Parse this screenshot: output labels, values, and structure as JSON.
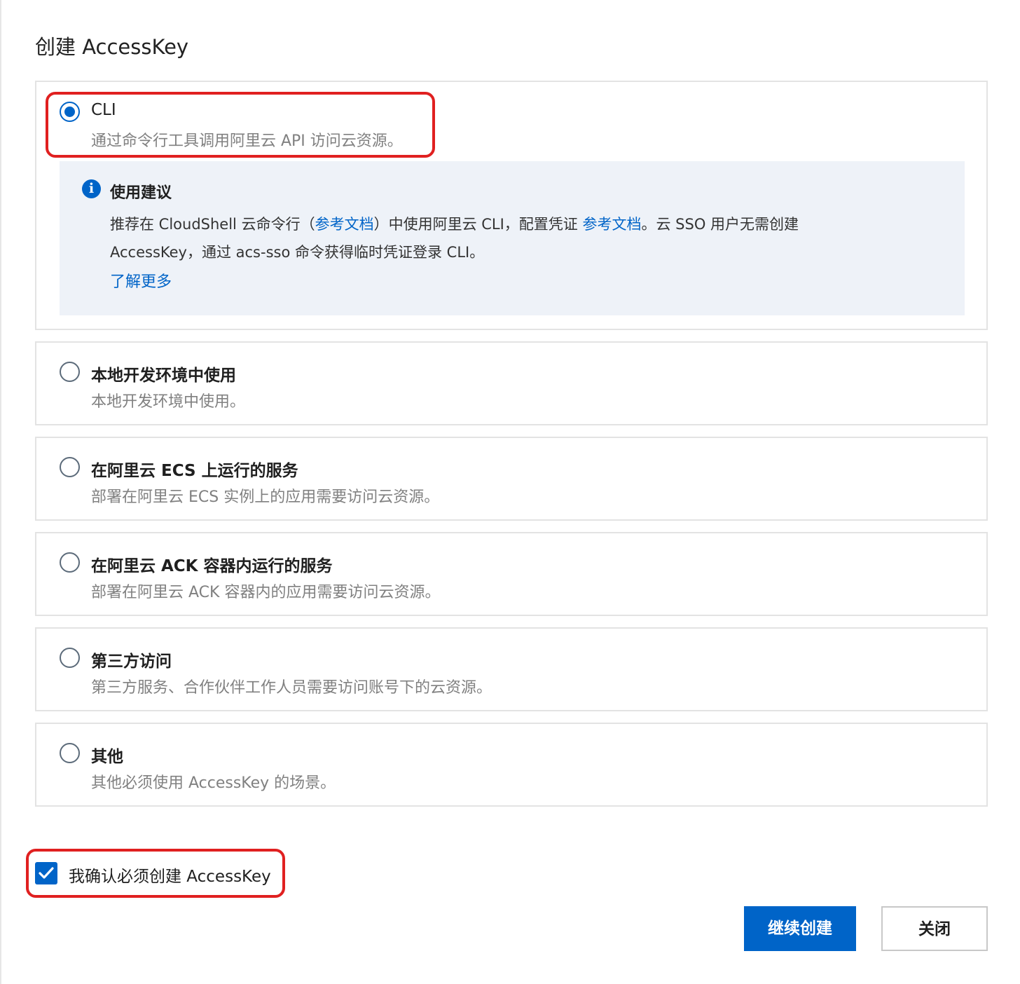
{
  "dialog": {
    "title": "创建 AccessKey"
  },
  "options": [
    {
      "id": "cli",
      "title": "CLI",
      "description": "通过命令行工具调用阿里云 API 访问云资源。",
      "selected": true
    },
    {
      "id": "local",
      "title": "本地开发环境中使用",
      "description": "本地开发环境中使用。",
      "selected": false
    },
    {
      "id": "ecs",
      "title": "在阿里云 ECS 上运行的服务",
      "description": "部署在阿里云 ECS 实例上的应用需要访问云资源。",
      "selected": false
    },
    {
      "id": "ack",
      "title": "在阿里云 ACK 容器内运行的服务",
      "description": "部署在阿里云 ACK 容器内的应用需要访问云资源。",
      "selected": false
    },
    {
      "id": "third",
      "title": "第三方访问",
      "description": "第三方服务、合作伙伴工作人员需要访问账号下的云资源。",
      "selected": false
    },
    {
      "id": "other",
      "title": "其他",
      "description": "其他必须使用 AccessKey 的场景。",
      "selected": false
    }
  ],
  "tip": {
    "title": "使用建议",
    "line1_part1": "推荐在 CloudShell 云命令行（",
    "line1_link1": "参考文档",
    "line1_part2": "）中使用阿里云 CLI，配置凭证 ",
    "line1_link2": "参考文档",
    "line1_part3": "。云 SSO 用户无需创建",
    "line2": "AccessKey，通过 acs-sso 命令获得临时凭证登录 CLI。",
    "more": "了解更多"
  },
  "confirm": {
    "label": "我确认必须创建 AccessKey",
    "checked": true
  },
  "buttons": {
    "continue": "继续创建",
    "close": "关闭"
  },
  "colors": {
    "primary": "#0064c8",
    "highlight": "#e02020",
    "tip_bg": "#eef2f8"
  }
}
